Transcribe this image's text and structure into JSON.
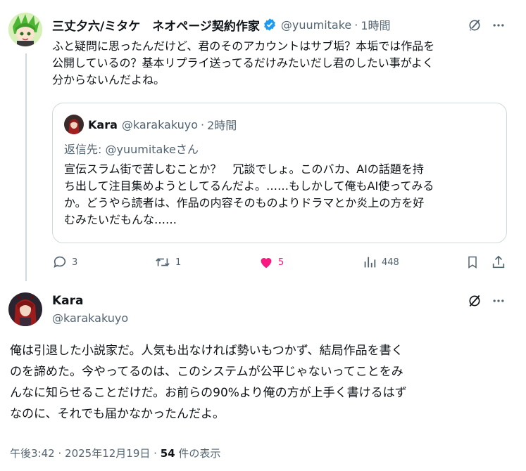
{
  "reply_tweet": {
    "author_name": "三丈夕六/ミタケ　ネオページ契約作家",
    "author_handle": "@yuumitake",
    "time_sep": "·",
    "time": "1時間",
    "text_lines": [
      "ふと疑問に思ったんだけど、君のそのアカウントはサブ垢？本垢では作品を",
      "公開しているの？基本リプライ送ってるだけみたいだし君のしたい事がよく",
      "分からないんだよね。"
    ],
    "quote": {
      "author_name": "Kara",
      "author_handle": "@karakakuyo",
      "time_sep": "·",
      "time": "2時間",
      "reply_prefix": "返信先: ",
      "reply_handle": "@yuumitake",
      "reply_suffix": "さん",
      "text_lines": [
        "宣伝スラム街で苦しむことか？　冗談でしょ。このバカ、AIの話題を持",
        "ち出して注目集めようとしてるんだよ。……もしかして俺もAI使ってみる",
        "か。どうやら読者は、作品の内容そのものよりドラマとか炎上の方を好",
        "むみたいだもんな……"
      ]
    },
    "actions": {
      "replies": "3",
      "reposts": "1",
      "likes": "5",
      "views": "448"
    }
  },
  "main_tweet": {
    "author_name": "Kara",
    "author_handle": "@karakakuyo",
    "text_lines": [
      "俺は引退した小説家だ。人気も出なければ勢いもつかず、結局作品を書く",
      "のを諦めた。今やってるのは、このシステムが公平じゃないってことをみ",
      "んなに知らせることだけだ。お前らの90%より俺の方が上手く書けるはず",
      "なのに、それでも届かなかったんだよ。"
    ],
    "meta": {
      "time": "午後3:42",
      "sep1": "·",
      "date": "2025年12月19日",
      "sep2": "·",
      "views_count": "54",
      "views_label": " 件の表示"
    }
  },
  "colors": {
    "text": "#0f1419",
    "muted": "#536471",
    "link": "#1d9bf0",
    "like": "#f91880",
    "verified": "#1d9bf0",
    "border": "#cfd9de"
  }
}
